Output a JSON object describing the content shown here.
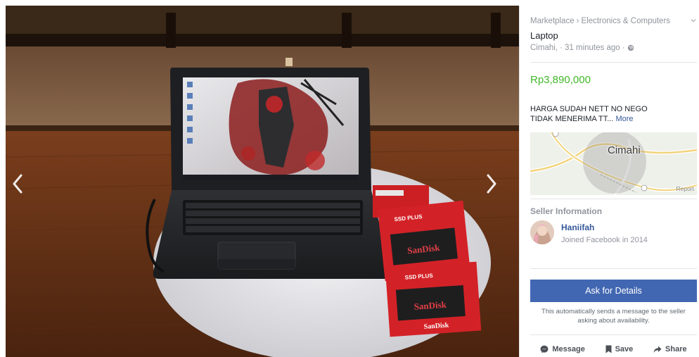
{
  "breadcrumb": {
    "root": "Marketplace",
    "separator": "›",
    "category": "Electronics & Computers"
  },
  "listing": {
    "title": "Laptop",
    "location": "Cimahi,",
    "posted": "· 31 minutes ago ·",
    "privacy_icon": "globe-icon",
    "price": "Rp3,890,000",
    "description_line1": "HARGA SUDAH NETT NO NEGO",
    "description_line2": "TIDAK MENERIMA TT...",
    "more_label": "More"
  },
  "map": {
    "city_label": "Cimahi",
    "report_label": "Report"
  },
  "seller": {
    "heading": "Seller Information",
    "name": "Haniifah",
    "joined": "Joined Facebook in 2014"
  },
  "cta": {
    "ask_label": "Ask for Details",
    "note_line1": "This automatically sends a message to the seller",
    "note_line2": "asking about availability."
  },
  "actions": {
    "message_label": "Message",
    "save_label": "Save",
    "share_label": "Share"
  },
  "photo": {
    "ssd_brand": "SanDisk",
    "ssd_model": "SSD PLUS"
  },
  "colors": {
    "price": "#42b72a",
    "primary_button": "#4267b2",
    "link": "#365899",
    "muted_text": "#90949c"
  }
}
